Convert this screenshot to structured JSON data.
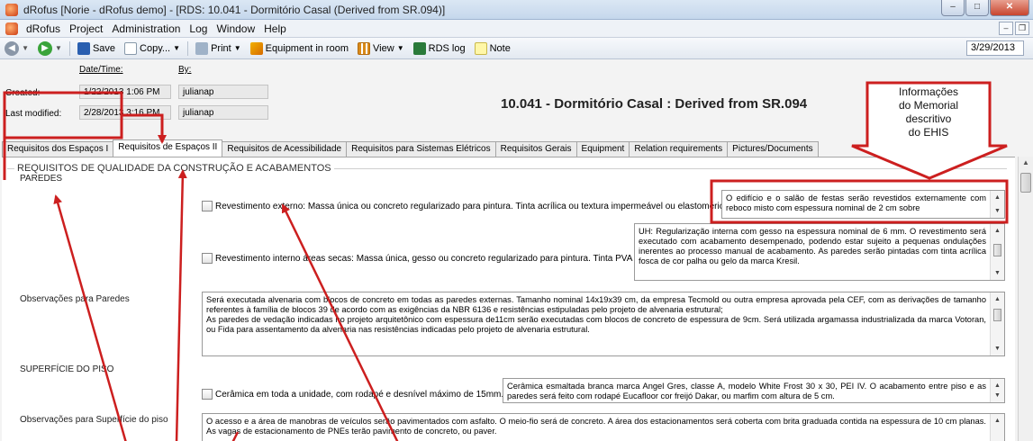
{
  "window": {
    "title": "dRofus [Norie - dRofus demo] - [RDS: 10.041 - Dormitório Casal (Derived from SR.094)]"
  },
  "menu": [
    "dRofus",
    "Project",
    "Administration",
    "Log",
    "Window",
    "Help"
  ],
  "toolbar": {
    "save": "Save",
    "copy": "Copy...",
    "print": "Print",
    "equipment": "Equipment in room",
    "view": "View",
    "rdslog": "RDS log",
    "note": "Note",
    "date": "3/29/2013"
  },
  "header": {
    "datetime_label": "Date/Time:",
    "by_label": "By:",
    "created_label": "Created:",
    "created_date": "1/22/2013 1:06 PM",
    "created_by": "julianap",
    "modified_label": "Last modified:",
    "modified_date": "2/28/2013 3:16 PM",
    "modified_by": "julianap",
    "room_title": "10.041 - Dormitório Casal : Derived from SR.094"
  },
  "callout": {
    "line1": "Informações",
    "line2": "do Memorial",
    "line3": "descritivo",
    "line4": "do EHIS"
  },
  "tabs": [
    "Requisitos dos Espaços I",
    "Requisitos de Espaços II",
    "Requisitos de Acessibilidade",
    "Requisitos para Sistemas Elétricos",
    "Requisitos Gerais",
    "Equipment",
    "Relation requirements",
    "Pictures/Documents"
  ],
  "group_title": "REQUISITOS DE QUALIDADE DA CONSTRUÇÃO E ACABAMENTOS",
  "paredes": {
    "heading": "PAREDES",
    "ext_label": "Revestimento externo: Massa única ou concreto regularizado para pintura. Tinta acrílica ou textura impermeável ou elastomérica",
    "ext_text": "O edifício e o salão de festas serão revestidos externamente com reboco misto com espessura nominal de 2 cm sobre",
    "int_label": "Revestimento interno áreas secas: Massa única, gesso ou concreto regularizado para pintura. Tinta PVA",
    "int_text": "UH: Regularização interna com gesso na espessura nominal de 6 mm. O revestimento será executado com acabamento desempenado, podendo estar sujeito a pequenas ondulações inerentes ao processo manual de acabamento. As paredes serão pintadas com tinta acrílica fosca de cor palha ou gelo da marca Kresil.",
    "obs_label": "Observações para Paredes",
    "obs_text1": "Será executada alvenaria com blocos de concreto em todas as paredes externas. Tamanho nominal 14x19x39 cm, da empresa Tecmold ou outra empresa aprovada pela CEF, com as derivações de tamanho referentes à família de blocos 39 de acordo com as exigências da NBR 6136 e resistências estipuladas pelo projeto de alvenaria estrutural;",
    "obs_text2": "As paredes de vedação indicadas no projeto arquitetônico com espessura de11cm serão executadas com blocos de concreto de espessura de 9cm. Será utilizada argamassa industrializada da marca Votoran, ou Fida para assentamento da alvenaria nas resistências indicadas pelo projeto de alvenaria estrutural."
  },
  "piso": {
    "heading": "SUPERFÍCIE DO PISO",
    "chk_label": "Cerâmica em toda a unidade, com rodapé e desnível máximo de 15mm.",
    "chk_text": "Cerâmica esmaltada branca marca Angel Gres, classe A, modelo White Frost 30 x 30, PEI IV. O acabamento entre piso e as paredes será feito com rodapé Eucafloor cor freijó Dakar, ou marfim com altura de 5 cm.",
    "obs_label": "Observações para Superfície do piso",
    "obs_text": "O acesso e a área de manobras de veículos serão pavimentados com asfalto. O meio-fio será de concreto. A área dos estacionamentos será coberta com brita graduada contida na espessura de 10 cm planas. As vagas de estacionamento de PNEs terão pavimento de concreto, ou paver."
  },
  "colors": {
    "annotation": "#cc1f1f",
    "tab_active_bg": "#ffffff"
  }
}
